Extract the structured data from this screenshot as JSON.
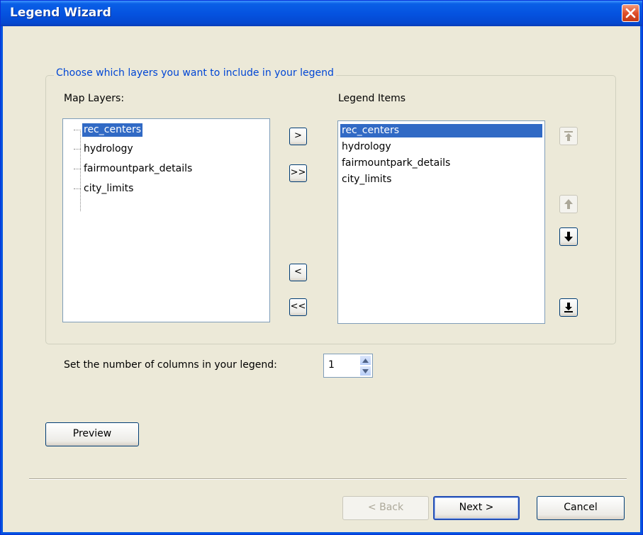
{
  "window": {
    "title": "Legend Wizard"
  },
  "group": {
    "title": "Choose which layers you want to include in your legend"
  },
  "map_layers": {
    "label": "Map Layers:",
    "items": [
      "rec_centers",
      "hydrology",
      "fairmountpark_details",
      "city_limits"
    ],
    "selected": "rec_centers"
  },
  "transfer_buttons": {
    "add": ">",
    "add_all": ">>",
    "remove": "<",
    "remove_all": "<<"
  },
  "legend_items": {
    "label": "Legend Items",
    "items": [
      "rec_centers",
      "hydrology",
      "fairmountpark_details",
      "city_limits"
    ],
    "selected": "rec_centers"
  },
  "order_buttons": {
    "move_top": "arrow-top-icon",
    "move_up": "arrow-up-icon",
    "move_down": "arrow-down-icon",
    "move_bottom": "arrow-bottom-icon"
  },
  "columns": {
    "label": "Set the number of columns in your legend:",
    "value": "1"
  },
  "preview_label": "Preview",
  "footer": {
    "back_label": "< Back",
    "next_label": "Next >",
    "cancel_label": "Cancel"
  },
  "colors": {
    "title_bar": "#0553e0",
    "selection": "#316ac5",
    "dialog_bg": "#ece9d8",
    "group_title": "#0046d5"
  }
}
